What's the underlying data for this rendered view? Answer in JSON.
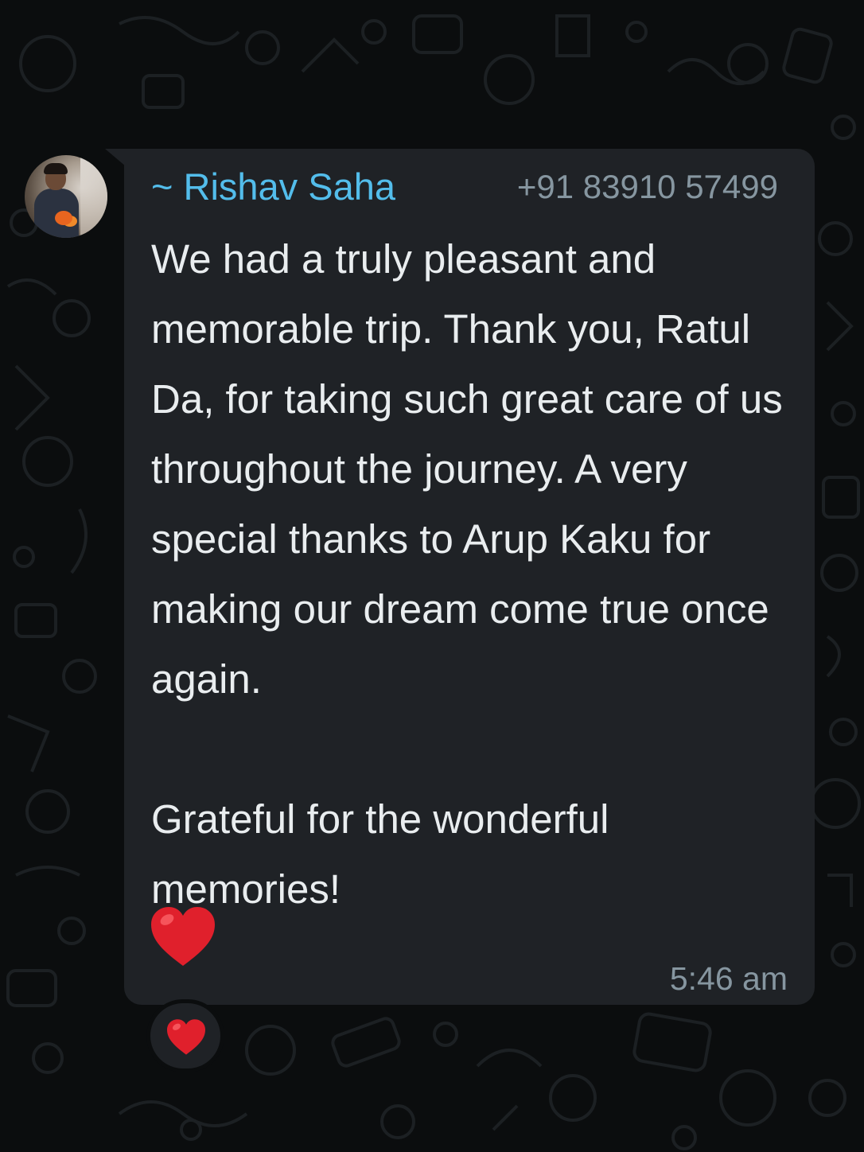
{
  "message": {
    "sender_name": "~ Rishav Saha",
    "sender_phone": "+91 83910 57499",
    "paragraphs": [
      "We had a truly pleasant and memorable trip. Thank you, Ratul Da, for taking such great care of us throughout the journey. A very special thanks to Arup Kaku for making our dream come true once again.",
      "Grateful for the wonderful memories!"
    ],
    "emoji": "red-heart",
    "time": "5:46 am",
    "reaction": "red-heart"
  },
  "colors": {
    "background": "#0b0d0e",
    "bubble": "#1f2226",
    "sender_name": "#53bdeb",
    "meta_text": "#8696a0",
    "message_text": "#e9edef",
    "heart": "#e0202c"
  }
}
